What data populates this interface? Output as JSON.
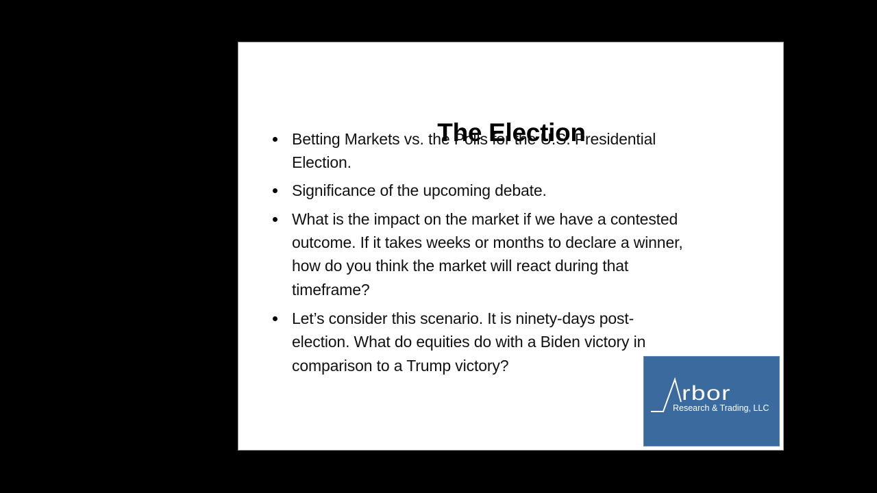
{
  "slide": {
    "title": "The Election",
    "bullets": [
      {
        "lines": [
          "Betting Markets vs. the Polls for the U.S. Presidential",
          "Election."
        ]
      },
      {
        "lines": [
          "Significance of the upcoming debate."
        ]
      },
      {
        "lines": [
          "What is the impact on the market if we have a contested",
          "outcome. If it takes weeks or months to declare a winner,",
          "how do you think the market will react during that",
          "timeframe?"
        ]
      },
      {
        "lines": [
          "Let’s consider this scenario. It is ninety-days post-",
          "election. What do equities do with a Biden victory in",
          "comparison to a Trump victory?"
        ]
      }
    ],
    "logo": {
      "name": "rbor",
      "full_name": "Arbor",
      "subtitle": "Research & Trading, LLC",
      "background_color": "#3b6a9f",
      "text_color": "#ffffff"
    }
  }
}
